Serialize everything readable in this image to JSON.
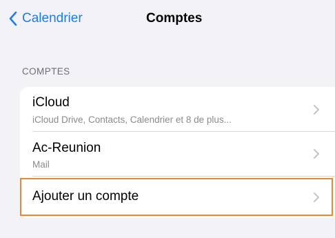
{
  "nav": {
    "back_label": "Calendrier",
    "title": "Comptes"
  },
  "section": {
    "header": "COMPTES"
  },
  "accounts": [
    {
      "title": "iCloud",
      "subtitle": "iCloud Drive, Contacts, Calendrier et 8 de plus..."
    },
    {
      "title": "Ac-Reunion",
      "subtitle": "Mail"
    }
  ],
  "add_account": {
    "label": "Ajouter un compte"
  },
  "colors": {
    "accent": "#1a7cf5",
    "background": "#f2f2f7",
    "highlight": "#f0862c",
    "secondary_text": "#8a8a8e"
  },
  "icons": {
    "back": "chevron-left-icon",
    "disclosure": "chevron-right-icon"
  }
}
